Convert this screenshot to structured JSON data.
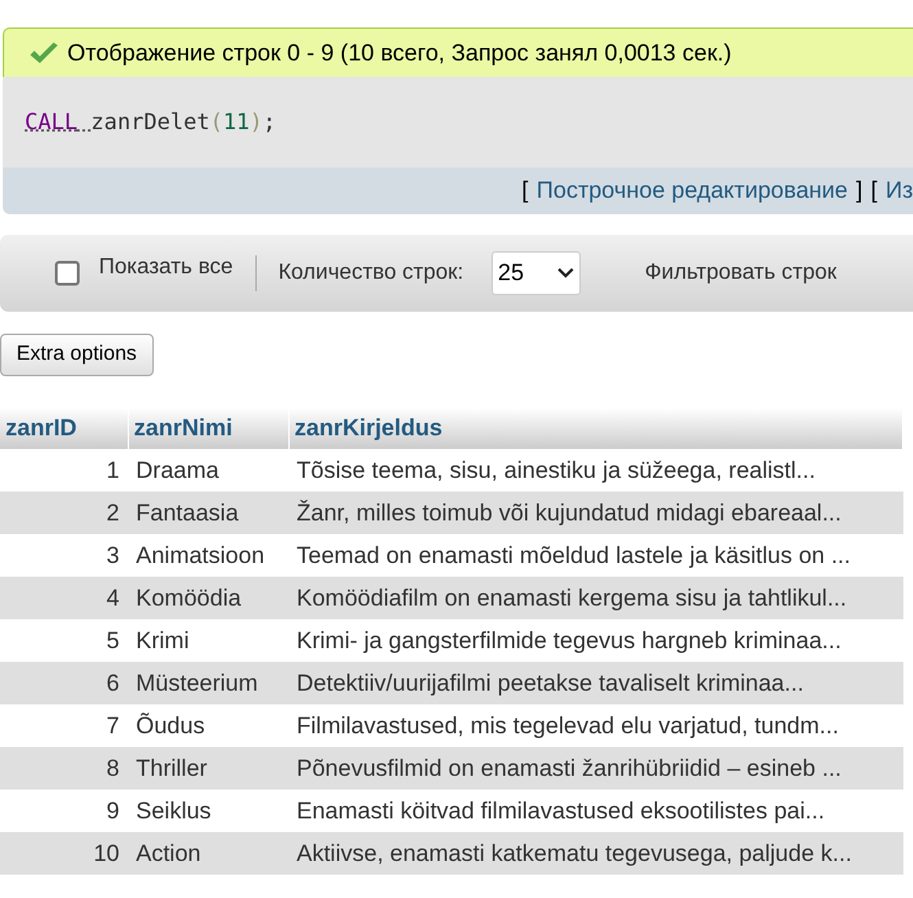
{
  "message": {
    "text": "Отображение строк 0 - 9 (10 всего, Запрос занял 0,0013 сек.)"
  },
  "sql": [
    {
      "kind": "keyword",
      "text": "CALL"
    },
    {
      "kind": "name",
      "text": "zanrDelet"
    },
    {
      "kind": "punct",
      "text": "("
    },
    {
      "kind": "number",
      "text": "11"
    },
    {
      "kind": "punct",
      "text": ")"
    },
    {
      "kind": "name",
      "text": ";"
    }
  ],
  "links": [
    {
      "before": "[",
      "label": "Построчное редактирование",
      "after": "]"
    },
    {
      "before": "[",
      "label": "Из"
    }
  ],
  "toolbar": {
    "show_all": {
      "label": "Показать все",
      "checked": false
    },
    "rows_label": "Количество строк:",
    "rows_value": "25",
    "filter_label": "Фильтровать строк"
  },
  "extra_button": "Extra options",
  "table": {
    "columns": [
      "zanrID",
      "zanrNimi",
      "zanrKirjeldus"
    ],
    "rows": [
      [
        "1",
        "Draama",
        "Tõsise teema, sisu, ainestiku ja süžeega, realistl..."
      ],
      [
        "2",
        "Fantaasia",
        "Žanr, milles toimub või kujundatud midagi ebareaal..."
      ],
      [
        "3",
        "Animatsioon",
        "Teemad on enamasti mõeldud lastele ja käsitlus on ..."
      ],
      [
        "4",
        "Komöödia",
        "Komöödiafilm on enamasti kergema sisu ja tahtlikul..."
      ],
      [
        "5",
        "Krimi",
        "Krimi- ja gangsterfilmide tegevus hargneb kriminaa..."
      ],
      [
        "6",
        "Müsteerium",
        "Detektiiv/uurijafilmi peetakse tavaliselt kriminaa..."
      ],
      [
        "7",
        "Õudus",
        "Filmilavastused, mis tegelevad elu varjatud, tundm..."
      ],
      [
        "8",
        "Thriller",
        "Põnevusfilmid on enamasti žanrihübriidid – esineb ..."
      ],
      [
        "9",
        "Seiklus",
        "Enamasti köitvad filmilavastused eksootilistes pai..."
      ],
      [
        "10",
        "Action",
        "Aktiivse, enamasti katkematu tegevusega, paljude k..."
      ]
    ]
  }
}
